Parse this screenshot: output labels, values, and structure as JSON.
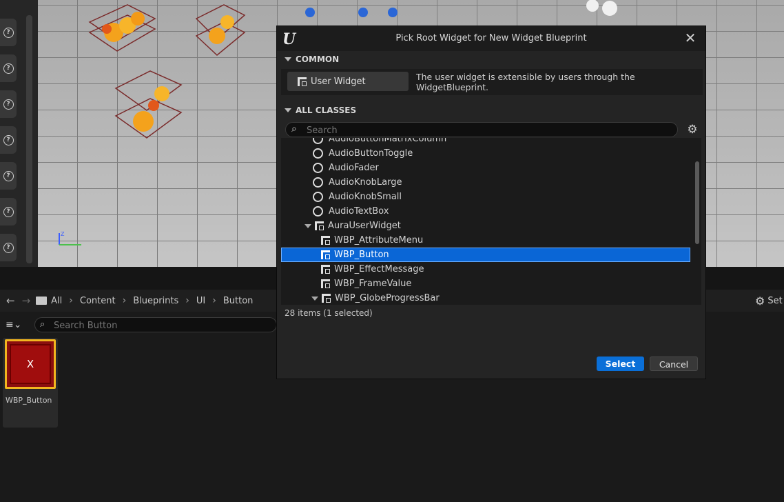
{
  "viewport": {
    "axis_label": "Z"
  },
  "toolbar": {
    "help_icon": "?"
  },
  "content_browser": {
    "breadcrumbs": [
      "All",
      "Content",
      "Blueprints",
      "UI",
      "Button"
    ],
    "search_placeholder": "Search Button",
    "settings_label": "Set",
    "asset": {
      "name": "WBP_Button",
      "thumb_glyph": "X"
    }
  },
  "dialog": {
    "title": "Pick Root Widget for New Widget Blueprint",
    "common_header": "COMMON",
    "common_button": "User Widget",
    "common_description": "The user widget is extensible by users through the WidgetBlueprint.",
    "all_classes_header": "ALL CLASSES",
    "search_placeholder": "Search",
    "items": [
      {
        "label": "AudioButtonMatrixColumn",
        "kind": "ring"
      },
      {
        "label": "AudioButtonToggle",
        "kind": "ring"
      },
      {
        "label": "AudioFader",
        "kind": "ring"
      },
      {
        "label": "AudioKnobLarge",
        "kind": "ring"
      },
      {
        "label": "AudioKnobSmall",
        "kind": "ring"
      },
      {
        "label": "AudioTextBox",
        "kind": "ring"
      },
      {
        "label": "AuraUserWidget",
        "kind": "widget-expand"
      },
      {
        "label": "WBP_AttributeMenu",
        "kind": "widget"
      },
      {
        "label": "WBP_Button",
        "kind": "widget",
        "selected": true
      },
      {
        "label": "WBP_EffectMessage",
        "kind": "widget"
      },
      {
        "label": "WBP_FrameValue",
        "kind": "widget"
      },
      {
        "label": "WBP_GlobeProgressBar",
        "kind": "widget-expand"
      }
    ],
    "item_count": "28 items (1 selected)",
    "select_label": "Select",
    "cancel_label": "Cancel"
  },
  "colors": {
    "accent": "#0a6fd8",
    "selection": "#0a66d6",
    "asset_border": "#f2b61f"
  }
}
